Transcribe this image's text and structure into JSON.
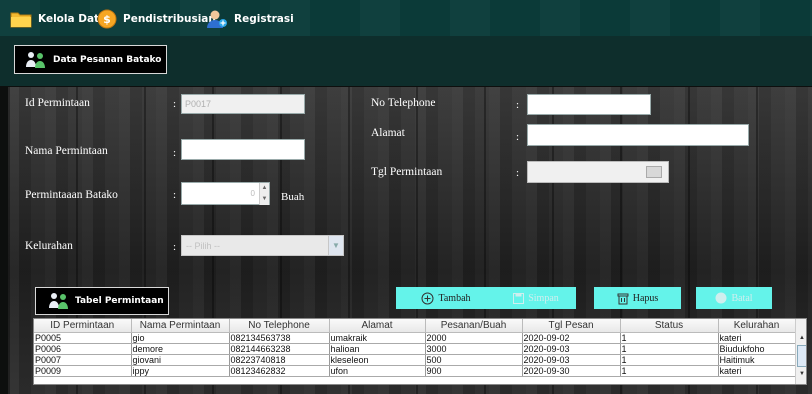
{
  "menu": {
    "kelola_data": "Kelola Data",
    "pendistribusian": "Pendistribusian",
    "registrasi": "Registrasi"
  },
  "toolbar": {
    "data_pesanan": "Data Pesanan Batako"
  },
  "form": {
    "id_label": "Id Permintaan",
    "id_value": "P0017",
    "nama_label": "Nama Permintaan",
    "nama_value": "",
    "jumlah_label": "Permintaaan Batako",
    "jumlah_value": "0",
    "unit": "Buah",
    "kelurahan_label": "Kelurahan",
    "kelurahan_value": "-- Pilih --",
    "telp_label": "No Telephone",
    "telp_value": "",
    "alamat_label": "Alamat",
    "alamat_value": "",
    "tgl_label": "Tgl Permintaan",
    "tgl_value": "",
    "colon": ":"
  },
  "table_section": {
    "title": "Tabel Permintaan"
  },
  "actions": {
    "tambah": "Tambah",
    "simpan": "Simpan",
    "hapus": "Hapus",
    "batal": "Batal"
  },
  "table": {
    "columns": [
      "ID Permintaan",
      "Nama Permintaan",
      "No Telephone",
      "Alamat",
      "Pesanan/Buah",
      "Tgl Pesan",
      "Status",
      "Kelurahan"
    ],
    "rows": [
      [
        "P0005",
        "gio",
        "082134563738",
        "umakraik",
        "2000",
        "2020-09-02",
        "1",
        "kateri"
      ],
      [
        "P0006",
        "demore",
        "082144663238",
        "halioan",
        "3000",
        "2020-09-03",
        "1",
        "Biudukfoho"
      ],
      [
        "P0007",
        "giovani",
        "08223740818",
        "kleseleon",
        "500",
        "2020-09-03",
        "1",
        "Haitimuk"
      ],
      [
        "P0009",
        "ippy",
        "08123462832",
        "ufon",
        "900",
        "2020-09-30",
        "1",
        "kateri"
      ]
    ]
  },
  "colors": {
    "accent": "#64f3ea",
    "menubar": "#0b3c3a",
    "toolbar": "#0e2e2c"
  }
}
